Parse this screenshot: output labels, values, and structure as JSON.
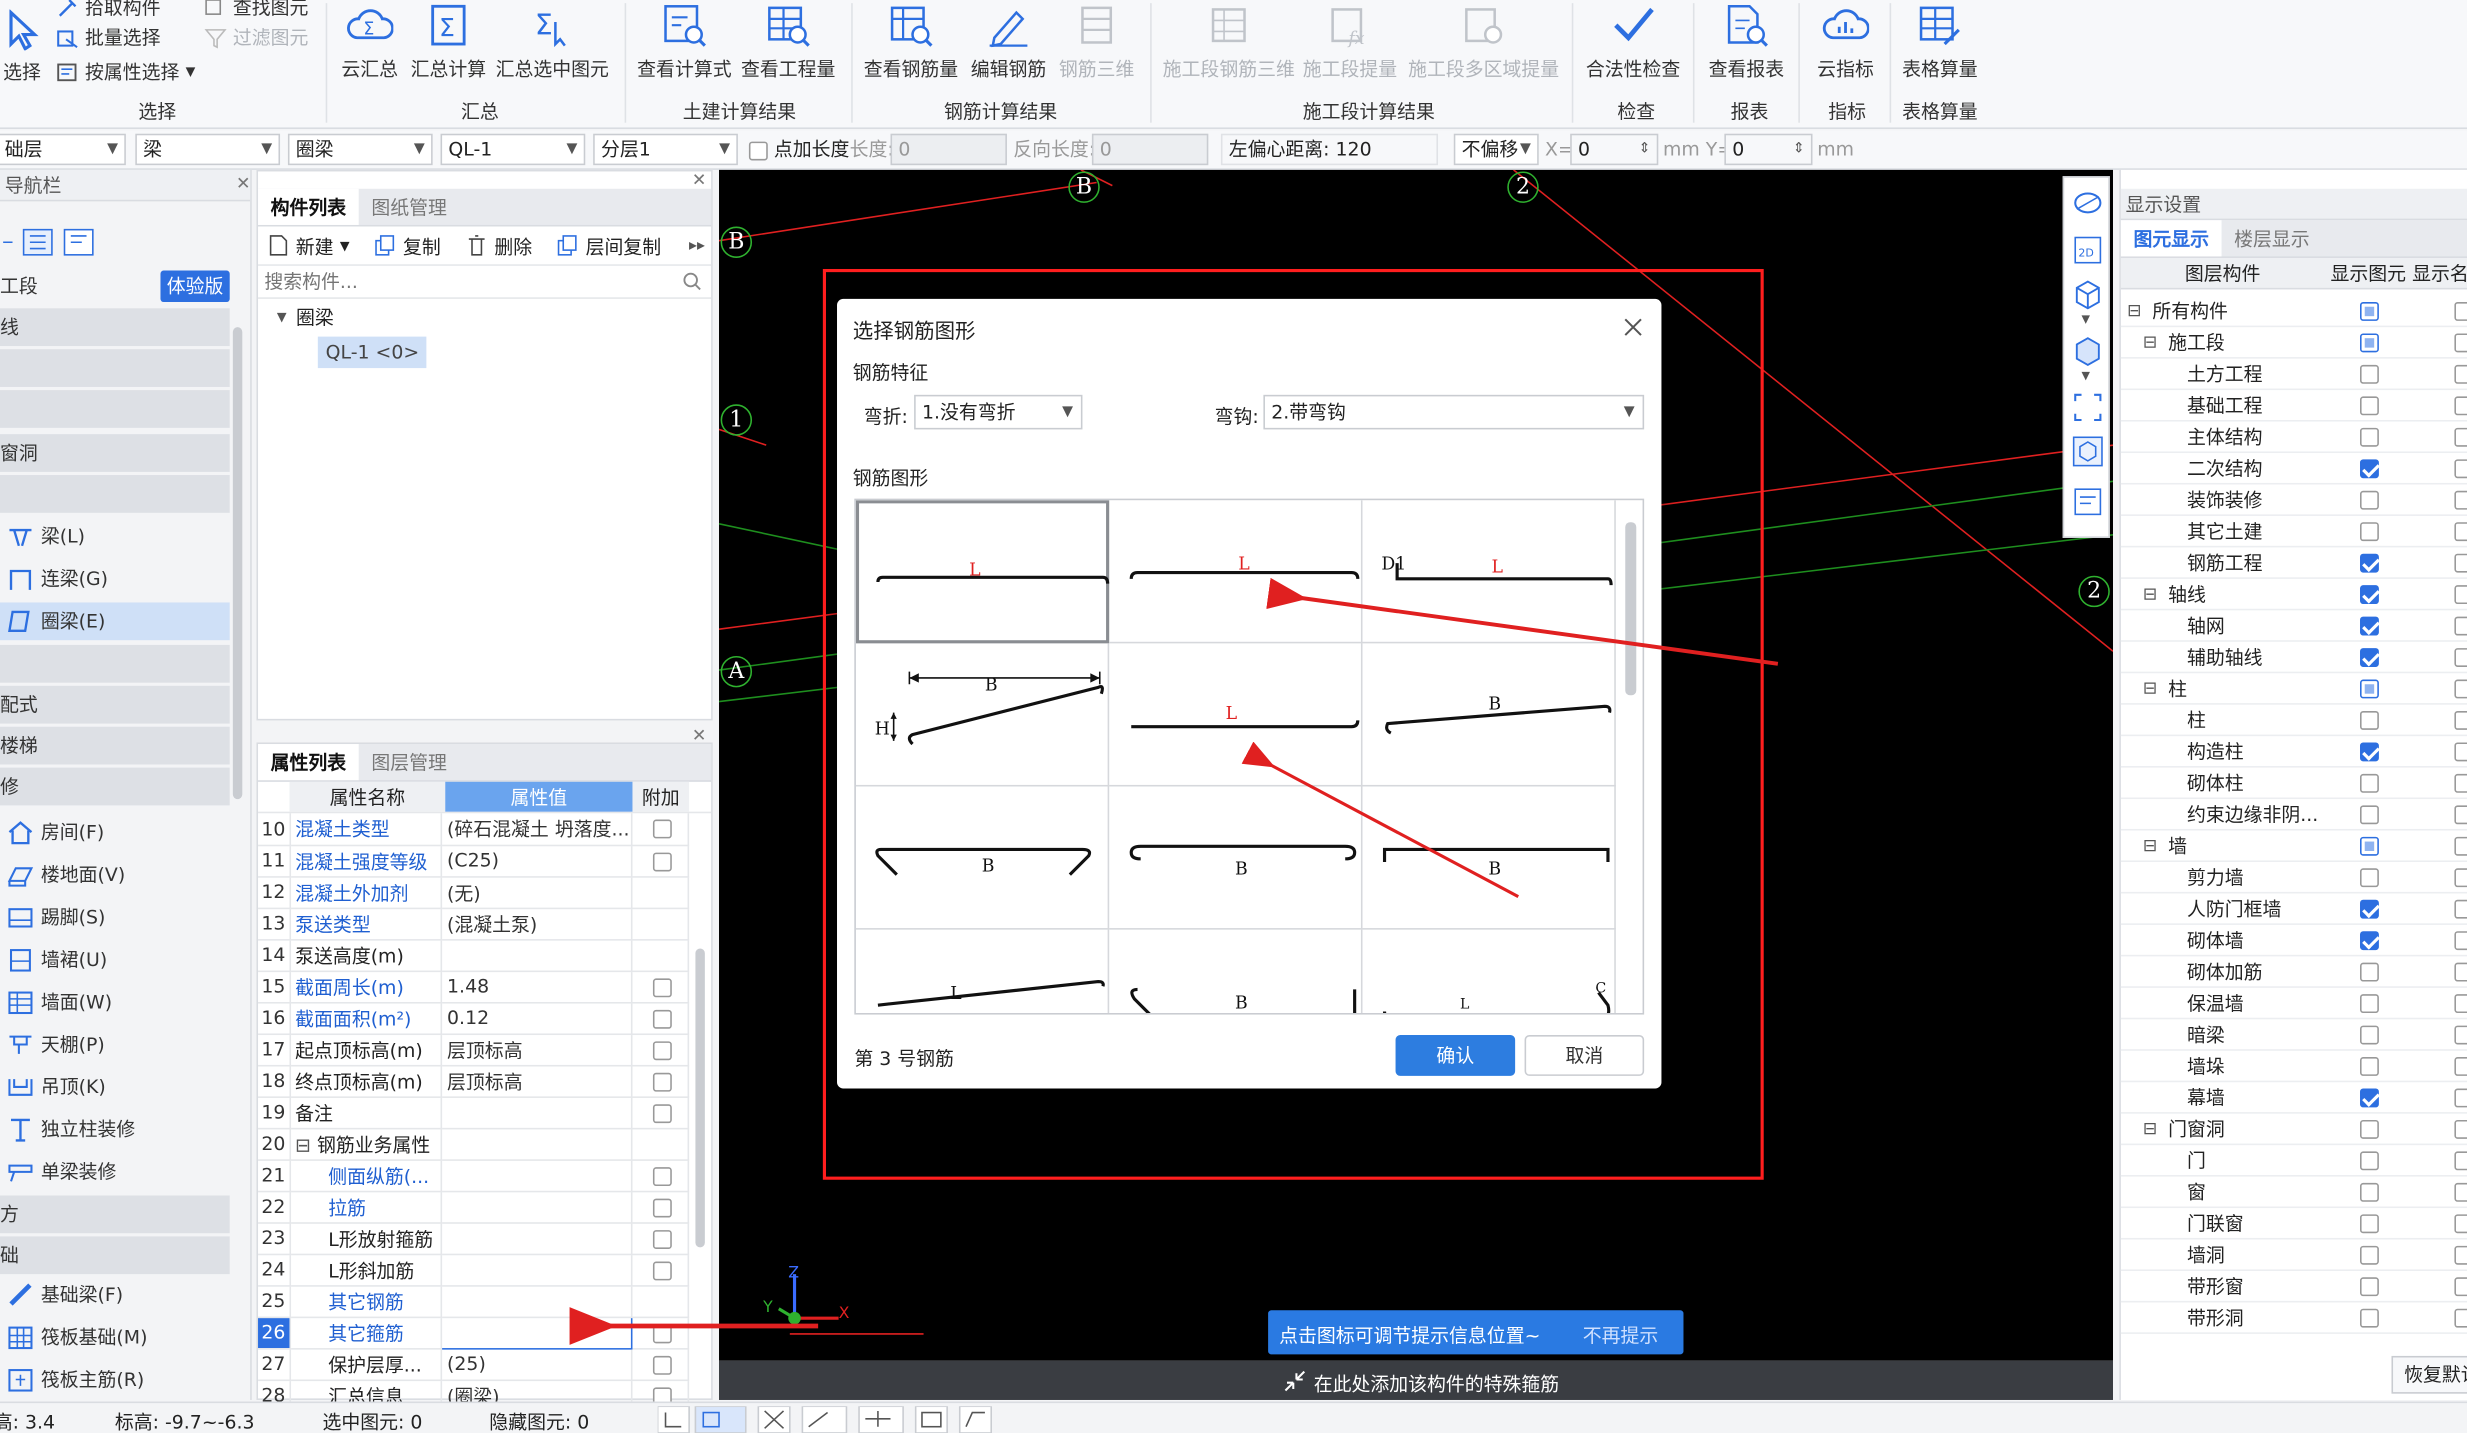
{
  "ribbon": {
    "select": {
      "label": "选择",
      "pick_label": "拾取构件",
      "batch_label": "批量选择",
      "attr_label": "按属性选择",
      "find_label": "查找图元",
      "filter_label": "过滤图元",
      "group": "选择"
    },
    "summary": {
      "cloud_label": "云汇总",
      "calc_label": "汇总计算",
      "sel_label": "汇总选中图元",
      "group": "汇总"
    },
    "civil": {
      "formula_label": "查看计算式",
      "qty_label": "查看工程量",
      "group": "土建计算结果"
    },
    "rebar": {
      "qty_label": "查看钢筋量",
      "edit_label": "编辑钢筋",
      "threed_label": "钢筋三维",
      "group": "钢筋计算结果"
    },
    "stage": {
      "rebar3d_label": "施工段钢筋三维",
      "qty_label": "施工段提量",
      "multi_label": "施工段多区域提量",
      "group": "施工段计算结果"
    },
    "check": {
      "legal_label": "合法性检查",
      "group": "检查"
    },
    "report": {
      "view_label": "查看报表",
      "group": "报表"
    },
    "index": {
      "cloud_label": "云指标",
      "group": "指标"
    },
    "table": {
      "calc_label": "表格算量",
      "group": "表格算量"
    }
  },
  "propbar": {
    "floor": "础层",
    "type": "梁",
    "subtype": "圈梁",
    "name": "QL-1",
    "layer": "分层1",
    "add_len_label": "点加长度",
    "len_label": "长度:",
    "len_value": "0",
    "rev_len_label": "反向长度:",
    "rev_len_value": "0",
    "left_offset": "左偏心距离: 120",
    "offset_mode": "不偏移",
    "x_label": "X=",
    "x_value": "0",
    "mm_y_label": "mm Y=",
    "y_value": "0",
    "mm_label": "mm"
  },
  "nav": {
    "title": "导航栏",
    "stage_label": "工段",
    "trial_badge": "体验版",
    "cats": [
      "线",
      "",
      "",
      "窗洞",
      ""
    ],
    "beam_items": [
      "梁(L)",
      "连梁(G)",
      "圈梁(E)"
    ],
    "cat2": [
      "",
      "配式",
      "楼梯",
      "修"
    ],
    "deco_items": [
      "房间(F)",
      "楼地面(V)",
      "踢脚(S)",
      "墙裙(U)",
      "墙面(W)",
      "天棚(P)",
      "吊顶(K)",
      "独立柱装修",
      "单梁装修"
    ],
    "cat3": [
      "方",
      "础"
    ],
    "found_items": [
      "基础梁(F)",
      "筏板基础(M)",
      "筏板主筋(R)"
    ]
  },
  "complist": {
    "tab1": "构件列表",
    "tab2": "图纸管理",
    "new_label": "新建",
    "copy_label": "复制",
    "delete_label": "删除",
    "layer_copy_label": "层间复制",
    "search_placeholder": "搜索构件...",
    "group_label": "圈梁",
    "item_label": "QL-1 <0>"
  },
  "proplist": {
    "tab1": "属性列表",
    "tab2": "图层管理",
    "col_name": "属性名称",
    "col_value": "属性值",
    "col_add": "附加",
    "rows": [
      {
        "n": "10",
        "k": "混凝土类型",
        "v": "(碎石混凝土 坍落度...",
        "blue": true,
        "cb": true
      },
      {
        "n": "11",
        "k": "混凝土强度等级",
        "v": "(C25)",
        "blue": true,
        "cb": true
      },
      {
        "n": "12",
        "k": "混凝土外加剂",
        "v": "(无)",
        "blue": true,
        "cb": false
      },
      {
        "n": "13",
        "k": "泵送类型",
        "v": "(混凝土泵)",
        "blue": true,
        "cb": false
      },
      {
        "n": "14",
        "k": "泵送高度(m)",
        "v": "",
        "blue": false,
        "cb": false
      },
      {
        "n": "15",
        "k": "截面周长(m)",
        "v": "1.48",
        "blue": true,
        "cb": true,
        "gray": true
      },
      {
        "n": "16",
        "k": "截面面积(m²)",
        "v": "0.12",
        "blue": true,
        "cb": true,
        "gray": true
      },
      {
        "n": "17",
        "k": "起点顶标高(m)",
        "v": "层顶标高",
        "blue": false,
        "cb": true
      },
      {
        "n": "18",
        "k": "终点顶标高(m)",
        "v": "层顶标高",
        "blue": false,
        "cb": true
      },
      {
        "n": "19",
        "k": "备注",
        "v": "",
        "blue": false,
        "cb": true
      },
      {
        "n": "20",
        "k": "钢筋业务属性",
        "v": "",
        "blue": false,
        "cb": false,
        "expand": true
      },
      {
        "n": "21",
        "k": "侧面纵筋(...",
        "v": "",
        "blue": true,
        "cb": true,
        "indent": true
      },
      {
        "n": "22",
        "k": "拉筋",
        "v": "",
        "blue": true,
        "cb": true,
        "indent": true
      },
      {
        "n": "23",
        "k": "L形放射箍筋",
        "v": "",
        "blue": false,
        "cb": true,
        "indent": true
      },
      {
        "n": "24",
        "k": "L形斜加筋",
        "v": "",
        "blue": false,
        "cb": true,
        "indent": true
      },
      {
        "n": "25",
        "k": "其它钢筋",
        "v": "",
        "blue": true,
        "cb": false,
        "indent": true
      },
      {
        "n": "26",
        "k": "其它箍筋",
        "v": "",
        "blue": true,
        "cb": true,
        "indent": true,
        "active": true
      },
      {
        "n": "27",
        "k": "保护层厚...",
        "v": "(25)",
        "blue": false,
        "cb": true,
        "indent": true
      },
      {
        "n": "28",
        "k": "汇总信息",
        "v": "(圈梁)",
        "blue": false,
        "cb": true,
        "indent": true
      }
    ]
  },
  "canvas": {
    "axes": {
      "B_top": "B",
      "two_top": "2",
      "B_left": "B",
      "one": "1",
      "A": "A",
      "two_right": "2"
    },
    "hint": "点击图标可调节提示信息位置~",
    "hint_dismiss": "不再提示",
    "add_label": "在此处添加该构件的特殊箍筋",
    "ucs": {
      "z": "Z",
      "y": "Y",
      "x": "X"
    }
  },
  "dialog": {
    "title": "选择钢筋图形",
    "feature_label": "钢筋特征",
    "bend_label": "弯折:",
    "bend_value": "1.没有弯折",
    "hook_label": "弯钩:",
    "hook_value": "2.带弯钩",
    "shape_label": "钢筋图形",
    "footer": "第 3 号钢筋",
    "ok_label": "确认",
    "cancel_label": "取消",
    "shape_texts": {
      "L": "L",
      "B": "B",
      "H": "H",
      "D1": "D1",
      "C": "C"
    }
  },
  "right": {
    "title": "显示设置",
    "tab1": "图元显示",
    "tab2": "楼层显示",
    "col1": "图层构件",
    "col2": "显示图元",
    "col3": "显示名",
    "restore_label": "恢复默认",
    "rows": [
      {
        "l": "所有构件",
        "lv": 0,
        "exp": true,
        "s": "part"
      },
      {
        "l": "施工段",
        "lv": 1,
        "exp": true,
        "s": "part"
      },
      {
        "l": "土方工程",
        "lv": 2,
        "s": "off"
      },
      {
        "l": "基础工程",
        "lv": 2,
        "s": "off"
      },
      {
        "l": "主体结构",
        "lv": 2,
        "s": "off"
      },
      {
        "l": "二次结构",
        "lv": 2,
        "s": "on"
      },
      {
        "l": "装饰装修",
        "lv": 2,
        "s": "off"
      },
      {
        "l": "其它土建",
        "lv": 2,
        "s": "off"
      },
      {
        "l": "钢筋工程",
        "lv": 2,
        "s": "on"
      },
      {
        "l": "轴线",
        "lv": 1,
        "exp": true,
        "s": "on"
      },
      {
        "l": "轴网",
        "lv": 2,
        "s": "on"
      },
      {
        "l": "辅助轴线",
        "lv": 2,
        "s": "on"
      },
      {
        "l": "柱",
        "lv": 1,
        "exp": true,
        "s": "part"
      },
      {
        "l": "柱",
        "lv": 2,
        "s": "off"
      },
      {
        "l": "构造柱",
        "lv": 2,
        "s": "on"
      },
      {
        "l": "砌体柱",
        "lv": 2,
        "s": "off"
      },
      {
        "l": "约束边缘非阴...",
        "lv": 2,
        "s": "off"
      },
      {
        "l": "墙",
        "lv": 1,
        "exp": true,
        "s": "part"
      },
      {
        "l": "剪力墙",
        "lv": 2,
        "s": "off"
      },
      {
        "l": "人防门框墙",
        "lv": 2,
        "s": "on"
      },
      {
        "l": "砌体墙",
        "lv": 2,
        "s": "on"
      },
      {
        "l": "砌体加筋",
        "lv": 2,
        "s": "off"
      },
      {
        "l": "保温墙",
        "lv": 2,
        "s": "off"
      },
      {
        "l": "暗梁",
        "lv": 2,
        "s": "off"
      },
      {
        "l": "墙垛",
        "lv": 2,
        "s": "off"
      },
      {
        "l": "幕墙",
        "lv": 2,
        "s": "on"
      },
      {
        "l": "门窗洞",
        "lv": 1,
        "exp": true,
        "s": "off"
      },
      {
        "l": "门",
        "lv": 2,
        "s": "off"
      },
      {
        "l": "窗",
        "lv": 2,
        "s": "off"
      },
      {
        "l": "门联窗",
        "lv": 2,
        "s": "off"
      },
      {
        "l": "墙洞",
        "lv": 2,
        "s": "off"
      },
      {
        "l": "带形窗",
        "lv": 2,
        "s": "off"
      },
      {
        "l": "带形洞",
        "lv": 2,
        "s": "off"
      }
    ]
  },
  "status": {
    "layer_h": "高: 3.4",
    "elev": "标高: -9.7~-6.3",
    "selected": "选中图元: 0",
    "hidden": "隐藏图元: 0"
  },
  "colors": {
    "accent": "#2d6fe0",
    "annotation": "#e02020",
    "axis": "#2fb12f"
  }
}
